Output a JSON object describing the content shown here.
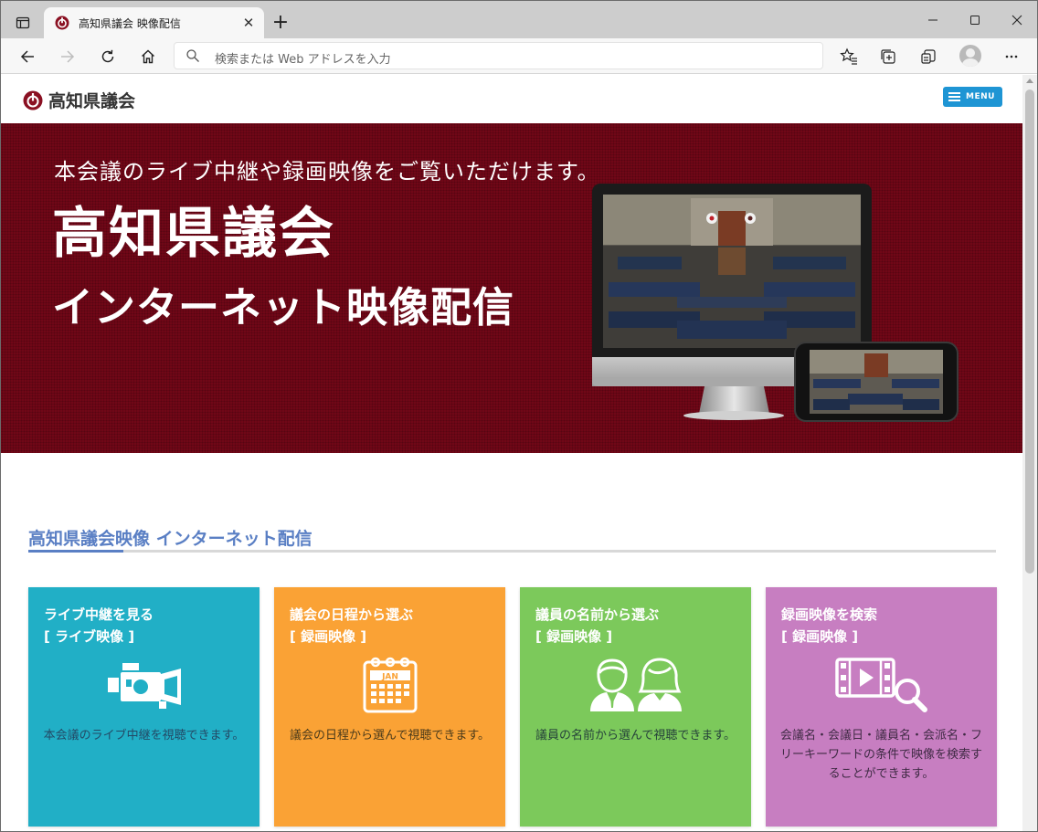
{
  "browser": {
    "tab_title": "高知県議会 映像配信",
    "address_placeholder": "検索または Web アドレスを入力"
  },
  "site": {
    "logo_text": "高知県議会",
    "menu_label": "MENU"
  },
  "hero": {
    "subtitle": "本会議のライブ中継や録画映像をご覧いただけます。",
    "title": "高知県議会",
    "title2": "インターネット映像配信"
  },
  "section": {
    "title": "高知県議会映像 インターネット配信"
  },
  "cards": [
    {
      "title": "ライブ中継を見る",
      "subtitle": "[ ライブ映像 ]",
      "icon": "video-camera-icon",
      "description": "本会議のライブ中継を視聴できます。"
    },
    {
      "title": "議会の日程から選ぶ",
      "subtitle": "[ 録画映像 ]",
      "icon": "calendar-icon",
      "calendar_label": "JAN",
      "description": "議会の日程から選んで視聴できます。"
    },
    {
      "title": "議員の名前から選ぶ",
      "subtitle": "[ 録画映像 ]",
      "icon": "people-icon",
      "description": "議員の名前から選んで視聴できます。"
    },
    {
      "title": "録画映像を検索",
      "subtitle": "[ 録画映像 ]",
      "icon": "video-search-icon",
      "description": "会議名・会議日・議員名・会派名・フリーキーワードの条件で映像を検索することができます。"
    }
  ],
  "colors": {
    "hero_bg": "#700717",
    "accent_blue": "#5a7fc4",
    "menu_button": "#1e95d4",
    "card_live": "#21afc6",
    "card_schedule": "#faa235",
    "card_member": "#7cc95b",
    "card_search": "#c77ec1"
  }
}
